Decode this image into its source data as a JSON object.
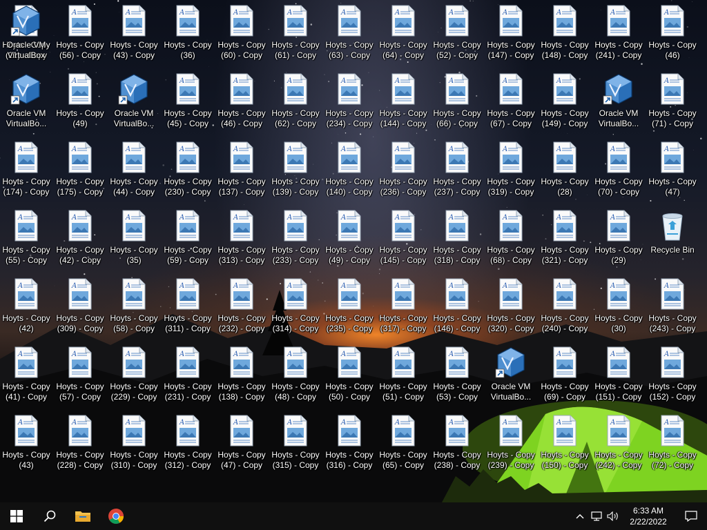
{
  "desktop": {
    "icons": [
      {
        "label": "Hoyts - Copy\n(21) - Copy",
        "type": "doc"
      },
      {
        "label": "Oracle VM\nVirtualBox",
        "type": "vbox"
      },
      {
        "label": "Hoyts - Copy\n(56) - Copy",
        "type": "doc"
      },
      {
        "label": "Hoyts - Copy\n(43) - Copy",
        "type": "doc"
      },
      {
        "label": "Hoyts - Copy\n(36)",
        "type": "doc"
      },
      {
        "label": "Hoyts - Copy\n(60) - Copy",
        "type": "doc"
      },
      {
        "label": "Hoyts - Copy\n(61) - Copy",
        "type": "doc"
      },
      {
        "label": "Hoyts - Copy\n(63) - Copy",
        "type": "doc"
      },
      {
        "label": "Hoyts - Copy\n(64) - Copy",
        "type": "doc"
      },
      {
        "label": "Hoyts - Copy\n(52) - Copy",
        "type": "doc"
      },
      {
        "label": "Hoyts - Copy\n(147) - Copy",
        "type": "doc"
      },
      {
        "label": "Hoyts - Copy\n(148) - Copy",
        "type": "doc"
      },
      {
        "label": "Hoyts - Copy\n(241) - Copy",
        "type": "doc"
      },
      {
        "label": "Hoyts - Copy\n(46)",
        "type": "doc"
      },
      {
        "label": "Oracle VM\nVirtualBo...",
        "type": "vbox"
      },
      {
        "label": "Hoyts - Copy\n(49)",
        "type": "doc"
      },
      {
        "label": "Oracle VM\nVirtualBo...",
        "type": "vbox"
      },
      {
        "label": "Hoyts - Copy\n(45) - Copy",
        "type": "doc"
      },
      {
        "label": "Hoyts - Copy\n(46) - Copy",
        "type": "doc"
      },
      {
        "label": "Hoyts - Copy\n(62) - Copy",
        "type": "doc"
      },
      {
        "label": "Hoyts - Copy\n(234) - Copy",
        "type": "doc"
      },
      {
        "label": "Hoyts - Copy\n(144) - Copy",
        "type": "doc"
      },
      {
        "label": "Hoyts - Copy\n(66) - Copy",
        "type": "doc"
      },
      {
        "label": "Hoyts - Copy\n(67) - Copy",
        "type": "doc"
      },
      {
        "label": "Hoyts - Copy\n(149) - Copy",
        "type": "doc"
      },
      {
        "label": "Oracle VM\nVirtualBo...",
        "type": "vbox"
      },
      {
        "label": "Hoyts - Copy\n(71) - Copy",
        "type": "doc"
      },
      {
        "label": "Hoyts - Copy\n(174) - Copy",
        "type": "doc"
      },
      {
        "label": "Hoyts - Copy\n(175) - Copy",
        "type": "doc"
      },
      {
        "label": "Hoyts - Copy\n(44) - Copy",
        "type": "doc"
      },
      {
        "label": "Hoyts - Copy\n(230) - Copy",
        "type": "doc"
      },
      {
        "label": "Hoyts - Copy\n(137) - Copy",
        "type": "doc"
      },
      {
        "label": "Hoyts - Copy\n(139) - Copy",
        "type": "doc"
      },
      {
        "label": "Hoyts - Copy\n(140) - Copy",
        "type": "doc"
      },
      {
        "label": "Hoyts - Copy\n(236) - Copy",
        "type": "doc"
      },
      {
        "label": "Hoyts - Copy\n(237) - Copy",
        "type": "doc"
      },
      {
        "label": "Hoyts - Copy\n(319) - Copy",
        "type": "doc"
      },
      {
        "label": "Hoyts - Copy\n(28)",
        "type": "doc"
      },
      {
        "label": "Hoyts - Copy\n(70) - Copy",
        "type": "doc"
      },
      {
        "label": "Hoyts - Copy\n(47)",
        "type": "doc"
      },
      {
        "label": "Hoyts - Copy\n(55) - Copy",
        "type": "doc"
      },
      {
        "label": "Hoyts - Copy\n(42) - Copy",
        "type": "doc"
      },
      {
        "label": "Hoyts - Copy\n(35)",
        "type": "doc"
      },
      {
        "label": "Hoyts - Copy\n(59) - Copy",
        "type": "doc"
      },
      {
        "label": "Hoyts - Copy\n(313) - Copy",
        "type": "doc"
      },
      {
        "label": "Hoyts - Copy\n(233) - Copy",
        "type": "doc"
      },
      {
        "label": "Hoyts - Copy\n(49) - Copy",
        "type": "doc"
      },
      {
        "label": "Hoyts - Copy\n(145) - Copy",
        "type": "doc"
      },
      {
        "label": "Hoyts - Copy\n(318) - Copy",
        "type": "doc"
      },
      {
        "label": "Hoyts - Copy\n(68) - Copy",
        "type": "doc"
      },
      {
        "label": "Hoyts - Copy\n(321) - Copy",
        "type": "doc"
      },
      {
        "label": "Hoyts - Copy\n(29)",
        "type": "doc"
      },
      {
        "label": "Recycle Bin",
        "type": "bin"
      },
      {
        "label": "Hoyts - Copy\n(42)",
        "type": "doc"
      },
      {
        "label": "Hoyts - Copy\n(309) - Copy",
        "type": "doc"
      },
      {
        "label": "Hoyts - Copy\n(58) - Copy",
        "type": "doc"
      },
      {
        "label": "Hoyts - Copy\n(311) - Copy",
        "type": "doc"
      },
      {
        "label": "Hoyts - Copy\n(232) - Copy",
        "type": "doc"
      },
      {
        "label": "Hoyts - Copy\n(314) - Copy",
        "type": "doc"
      },
      {
        "label": "Hoyts - Copy\n(235) - Copy",
        "type": "doc"
      },
      {
        "label": "Hoyts - Copy\n(317) - Copy",
        "type": "doc"
      },
      {
        "label": "Hoyts - Copy\n(146) - Copy",
        "type": "doc"
      },
      {
        "label": "Hoyts - Copy\n(320) - Copy",
        "type": "doc"
      },
      {
        "label": "Hoyts - Copy\n(240) - Copy",
        "type": "doc"
      },
      {
        "label": "Hoyts - Copy\n(30)",
        "type": "doc"
      },
      {
        "label": "Hoyts - Copy\n(243) - Copy",
        "type": "doc"
      },
      {
        "label": "Hoyts - Copy\n(41) - Copy",
        "type": "doc"
      },
      {
        "label": "Hoyts - Copy\n(57) - Copy",
        "type": "doc"
      },
      {
        "label": "Hoyts - Copy\n(229) - Copy",
        "type": "doc"
      },
      {
        "label": "Hoyts - Copy\n(231) - Copy",
        "type": "doc"
      },
      {
        "label": "Hoyts - Copy\n(138) - Copy",
        "type": "doc"
      },
      {
        "label": "Hoyts - Copy\n(48) - Copy",
        "type": "doc"
      },
      {
        "label": "Hoyts - Copy\n(50) - Copy",
        "type": "doc"
      },
      {
        "label": "Hoyts - Copy\n(51) - Copy",
        "type": "doc"
      },
      {
        "label": "Hoyts - Copy\n(53) - Copy",
        "type": "doc"
      },
      {
        "label": "Oracle VM\nVirtualBo...",
        "type": "vbox"
      },
      {
        "label": "Hoyts - Copy\n(69) - Copy",
        "type": "doc"
      },
      {
        "label": "Hoyts - Copy\n(151) - Copy",
        "type": "doc"
      },
      {
        "label": "Hoyts - Copy\n(152) - Copy",
        "type": "doc"
      },
      {
        "label": "Hoyts - Copy\n(43)",
        "type": "doc"
      },
      {
        "label": "Hoyts - Copy\n(228) - Copy",
        "type": "doc"
      },
      {
        "label": "Hoyts - Copy\n(310) - Copy",
        "type": "doc"
      },
      {
        "label": "Hoyts - Copy\n(312) - Copy",
        "type": "doc"
      },
      {
        "label": "Hoyts - Copy\n(47) - Copy",
        "type": "doc"
      },
      {
        "label": "Hoyts - Copy\n(315) - Copy",
        "type": "doc"
      },
      {
        "label": "Hoyts - Copy\n(316) - Copy",
        "type": "doc"
      },
      {
        "label": "Hoyts - Copy\n(65) - Copy",
        "type": "doc"
      },
      {
        "label": "Hoyts - Copy\n(238) - Copy",
        "type": "doc"
      },
      {
        "label": "Hoyts - Copy\n(239) - Copy",
        "type": "doc"
      },
      {
        "label": "Hoyts - Copy\n(150) - Copy",
        "type": "doc"
      },
      {
        "label": "Hoyts - Copy\n(242) - Copy",
        "type": "doc"
      },
      {
        "label": "Hoyts - Copy\n(72) - Copy",
        "type": "doc"
      }
    ]
  },
  "taskbar": {
    "pinned": [
      {
        "name": "start-button",
        "icon": "windows-logo-icon"
      },
      {
        "name": "search-button",
        "icon": "search-icon"
      },
      {
        "name": "file-explorer-button",
        "icon": "folder-icon"
      },
      {
        "name": "chrome-button",
        "icon": "chrome-icon"
      }
    ],
    "tray": [
      {
        "name": "show-hidden-icons-button",
        "icon": "chevron-up-icon"
      },
      {
        "name": "network-button",
        "icon": "network-icon"
      },
      {
        "name": "volume-button",
        "icon": "speaker-icon"
      }
    ],
    "clock": {
      "time": "6:33 AM",
      "date": "2/22/2022"
    },
    "notifications_icon": "notification-icon"
  },
  "colors": {
    "taskbar": "#101010",
    "label_text": "#ffffff",
    "tent_green": "#7ed321",
    "sunset_orange": "#ff8c28"
  }
}
